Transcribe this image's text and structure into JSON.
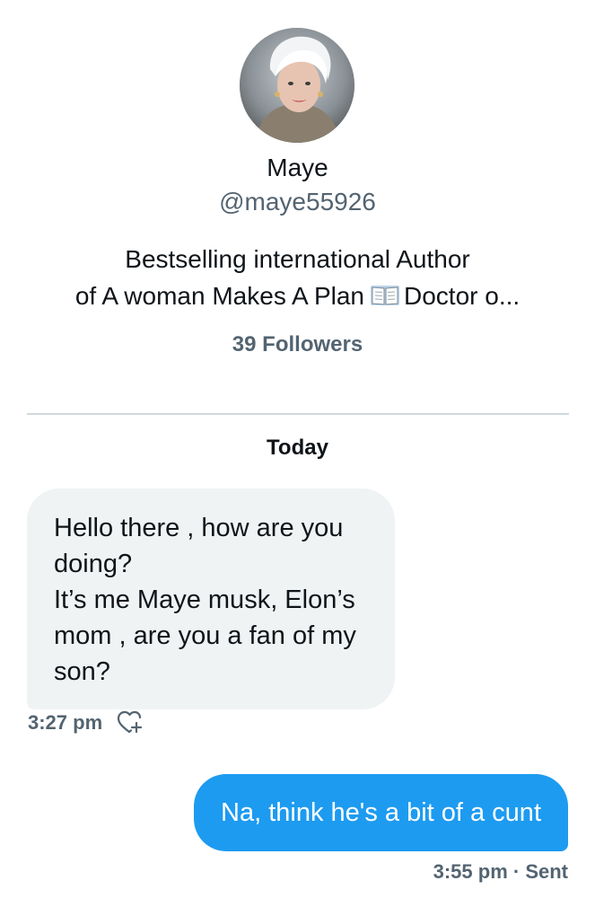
{
  "profile": {
    "name": "Maye",
    "handle": "@maye55926",
    "bio_line1": "Bestselling international Author",
    "bio_line2_pre": "of A woman Makes A Plan",
    "bio_line2_post": "Doctor o...",
    "bio_icon": "open-book-emoji",
    "followers": "39 Followers"
  },
  "conversation": {
    "day_label": "Today",
    "messages": [
      {
        "direction": "incoming",
        "lines": [
          "Hello there , how are you doing?",
          "It’s me Maye musk, Elon’s mom , are you a fan of my son?"
        ],
        "time": "3:27 pm",
        "react_icon": "heart-plus-icon"
      },
      {
        "direction": "outgoing",
        "text": "Na, think he's a bit of a cunt",
        "time_status": "3:55 pm · Sent"
      }
    ]
  },
  "colors": {
    "accent": "#1d9bf0",
    "secondary_text": "#536471",
    "incoming_bubble": "#eff3f4",
    "divider": "#cfd9de"
  }
}
